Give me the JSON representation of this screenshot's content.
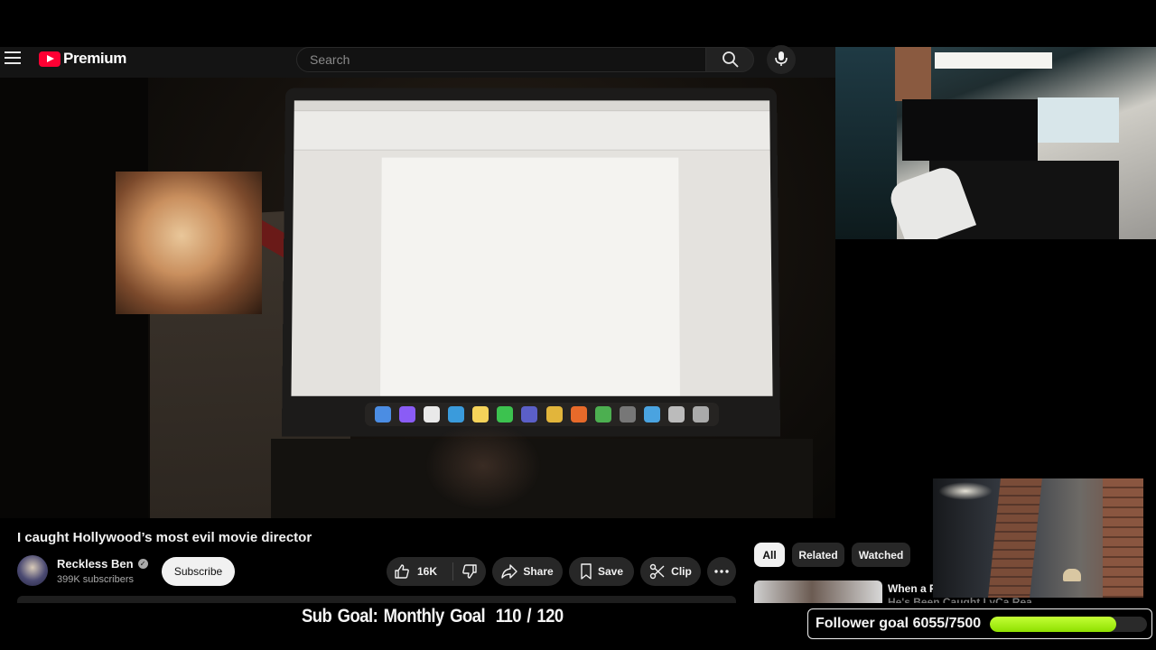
{
  "masthead": {
    "logo_text": "Premium",
    "search_placeholder": "Search"
  },
  "video": {
    "title": "I caught Hollywood’s most evil movie director"
  },
  "channel": {
    "name": "Reckless Ben",
    "subscribers": "399K subscribers",
    "subscribe_label": "Subscribe"
  },
  "actions": {
    "like_count": "16K",
    "share_label": "Share",
    "save_label": "Save",
    "clip_label": "Clip"
  },
  "sidebar": {
    "chips": [
      {
        "label": "All",
        "active": true
      },
      {
        "label": "Related",
        "active": false
      },
      {
        "label": "Watched",
        "active": false
      }
    ],
    "recommendation": {
      "title": "When a P",
      "subtitle": "He's Been Caught LyCa Reacts"
    }
  },
  "overlay": {
    "sub_goal_label": "Sub Goal: Monthly Goal",
    "sub_goal_current": "110",
    "sub_goal_target": "120",
    "follower_goal_label": "Follower goal 6055/7500",
    "follower_progress": 0.807,
    "progress_color": "#a8f000"
  },
  "colors": {
    "youtube_red": "#ff0033",
    "background": "#000000",
    "pill": "#272727"
  }
}
